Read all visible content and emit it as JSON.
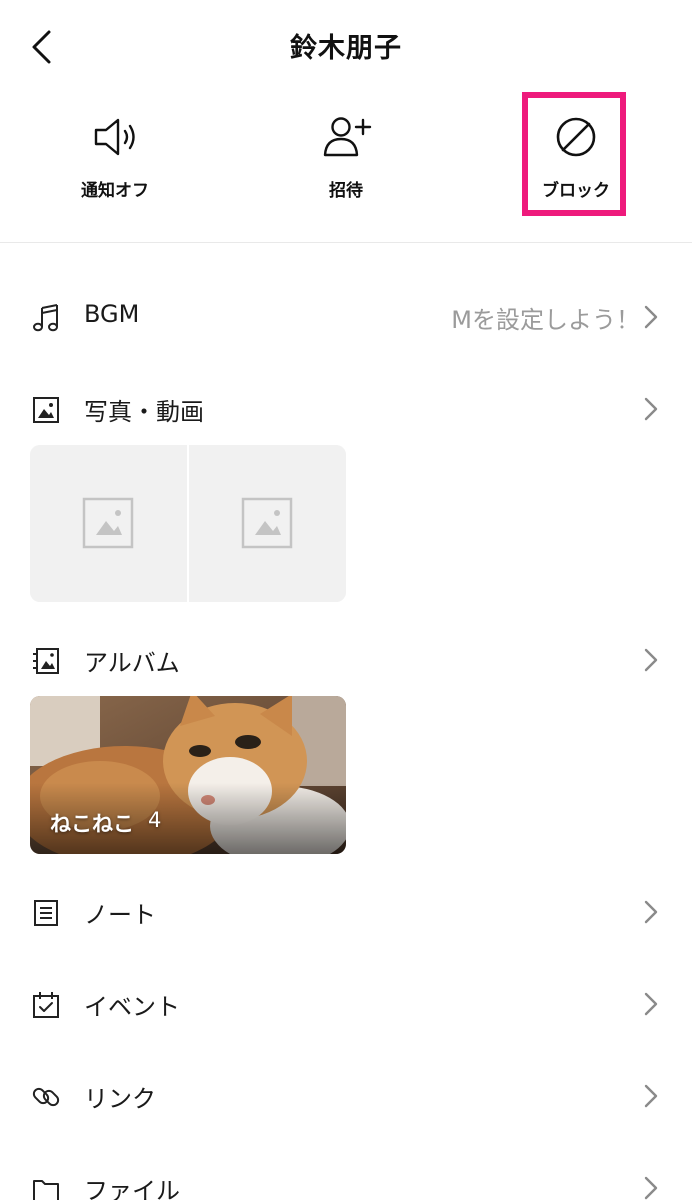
{
  "header": {
    "title": "鈴木朋子",
    "back_icon": "chevron-left-icon"
  },
  "actions": [
    {
      "id": "mute",
      "label": "通知オフ",
      "icon": "speaker-icon"
    },
    {
      "id": "invite",
      "label": "招待",
      "icon": "add-user-icon"
    },
    {
      "id": "block",
      "label": "ブロック",
      "icon": "block-icon",
      "highlighted": true
    }
  ],
  "highlight_color": "#ee1a7c",
  "rows": {
    "bgm": {
      "label": "BGM",
      "value": "Mを設定しよう！",
      "icon": "music-note-icon"
    },
    "photos": {
      "label": "写真・動画",
      "icon": "photo-icon"
    },
    "album": {
      "label": "アルバム",
      "icon": "album-icon"
    },
    "note": {
      "label": "ノート",
      "icon": "note-icon"
    },
    "event": {
      "label": "イベント",
      "icon": "calendar-check-icon"
    },
    "link": {
      "label": "リンク",
      "icon": "link-icon"
    },
    "file": {
      "label": "ファイル",
      "icon": "folder-icon"
    }
  },
  "album_card": {
    "name": "ねこねこ",
    "count": "4"
  }
}
